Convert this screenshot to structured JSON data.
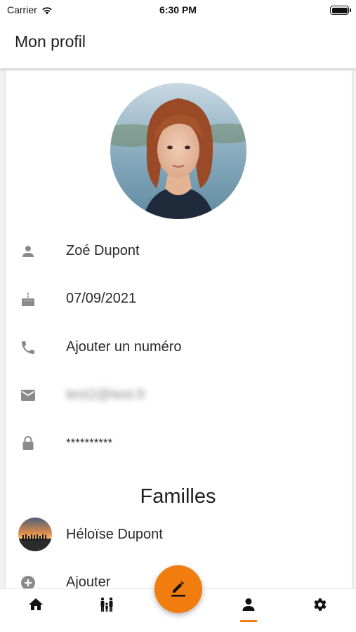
{
  "status_bar": {
    "carrier": "Carrier",
    "time": "6:30 PM"
  },
  "app_bar": {
    "title": "Mon profil"
  },
  "profile": {
    "name": "Zoé Dupont",
    "birthdate": "07/09/2021",
    "phone": "Ajouter un numéro",
    "email": "test2@test.fr",
    "password": "**********"
  },
  "families": {
    "title": "Familles",
    "items": [
      {
        "name": "Héloïse Dupont"
      }
    ],
    "add_label": "Ajouter"
  },
  "bottom_nav": {
    "items": [
      {
        "icon": "home-icon"
      },
      {
        "icon": "family-icon"
      },
      {
        "icon": "person-icon",
        "active": true
      },
      {
        "icon": "gear-icon"
      }
    ]
  },
  "colors": {
    "accent": "#f07d0d",
    "icon_gray": "#8a8a8a",
    "text": "#2a2a2a"
  }
}
